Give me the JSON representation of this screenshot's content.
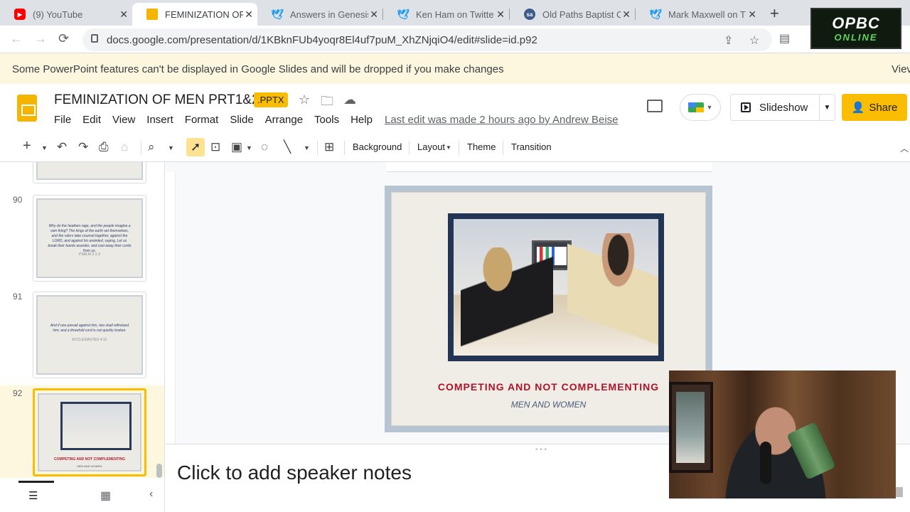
{
  "browser": {
    "tabs": [
      {
        "title": "(9) YouTube",
        "icon": "youtube-icon",
        "color": "#ff0000"
      },
      {
        "title": "FEMINIZATION OF",
        "icon": "slides-icon",
        "color": "#f4b400"
      },
      {
        "title": "Answers in Genesis",
        "icon": "twitter-icon",
        "color": "#1d9bf0"
      },
      {
        "title": "Ken Ham on Twitter",
        "icon": "twitter-icon",
        "color": "#1d9bf0"
      },
      {
        "title": "Old Paths Baptist C",
        "icon": "sa-icon",
        "color": "#3c5a8a"
      },
      {
        "title": "Mark Maxwell on T",
        "icon": "twitter-icon",
        "color": "#1d9bf0"
      }
    ],
    "url": "docs.google.com/presentation/d/1KBknFUb4yoqr8El4uf7puM_XhZNjqiO4/edit#slide=id.p92",
    "overlay_logo": {
      "line1": "OPBC",
      "line2": "ONLINE"
    }
  },
  "banner": {
    "message": "Some PowerPoint features can't be displayed in Google Slides and will be dropped if you make changes",
    "view": "Viev"
  },
  "app": {
    "title": "FEMINIZATION OF MEN PRT1&2",
    "badge": ".PPTX",
    "menus": [
      "File",
      "Edit",
      "View",
      "Insert",
      "Format",
      "Slide",
      "Arrange",
      "Tools",
      "Help"
    ],
    "last_edit": "Last edit was made 2 hours ago by Andrew Beise",
    "slideshow_label": "Slideshow",
    "share_label": "Share",
    "accent": "#fbbc04"
  },
  "toolbar": {
    "background": "Background",
    "layout": "Layout",
    "theme": "Theme",
    "transition": "Transition"
  },
  "filmstrip": {
    "slides": [
      {
        "number": "90",
        "text": "Why do the heathen rage, and the people imagine a vain thing? The kings of the earth set themselves, and the rulers take counsel together, against the LORD, and against his anointed, saying, Let us break their bands asunder, and cast away their cords from us.",
        "ref": "PSALM 2:1-3"
      },
      {
        "number": "91",
        "text": "And if one prevail against him, two shall withstand him; and a threefold cord is not quickly broken.",
        "ref": "ECCLESIASTES 4:12"
      },
      {
        "number": "92",
        "caption": "COMPETING AND NOT COMPLEMENTING",
        "subcaption": "MEN AND WOMEN"
      }
    ]
  },
  "slide": {
    "caption": "COMPETING AND NOT COMPLEMENTING",
    "subcaption": "MEN AND WOMEN"
  },
  "notes": {
    "placeholder": "Click to add speaker notes"
  }
}
